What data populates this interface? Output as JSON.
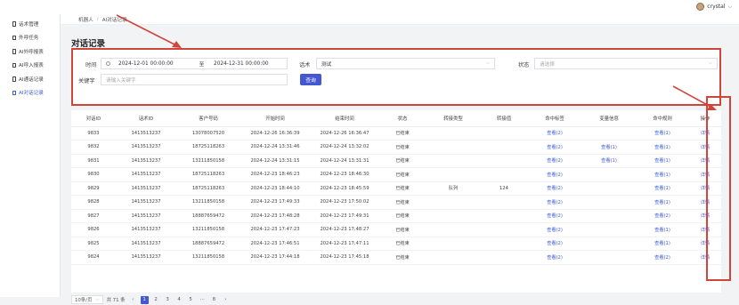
{
  "header": {
    "user_name": "crystal"
  },
  "sidebar": {
    "items": [
      {
        "label": "话术管理",
        "active": false
      },
      {
        "label": "外呼任务",
        "active": false
      },
      {
        "label": "AI外呼报表",
        "active": false
      },
      {
        "label": "AI呼入报表",
        "active": false
      },
      {
        "label": "AI通话记录",
        "active": false
      },
      {
        "label": "AI对话记录",
        "active": true
      }
    ]
  },
  "breadcrumb": [
    "机器人",
    "AI对话记录"
  ],
  "page_title": "对话记录",
  "filter": {
    "time_label": "时间",
    "start_value": "2024-12-01 00:00:00",
    "range_sep": "至",
    "end_value": "2024-12-31 00:00:00",
    "script_label": "话术",
    "script_value": "测试",
    "status_label": "状态",
    "status_placeholder": "请选择",
    "keyword_label": "关键字",
    "keyword_placeholder": "请输入关键字",
    "search_button": "查询"
  },
  "table": {
    "columns": [
      "对话ID",
      "话术ID",
      "客户号码",
      "开始时间",
      "结束时间",
      "状态",
      "转接类型",
      "转接值",
      "命中标签",
      "变量信息",
      "命中规则",
      "操作"
    ],
    "rows": [
      [
        "9833",
        "1413513237",
        "13078007520",
        "2024-12-26 16:36:39",
        "2024-12-26 16:36:47",
        "已结束",
        "",
        "",
        "查看(2)",
        "",
        "查看(1)",
        "详情"
      ],
      [
        "9832",
        "1413513237",
        "18725118263",
        "2024-12-24 13:31:46",
        "2024-12-24 13:32:02",
        "已结束",
        "",
        "",
        "查看(2)",
        "查看(1)",
        "查看(1)",
        "详情"
      ],
      [
        "9831",
        "1413513237",
        "13211850158",
        "2024-12-24 13:31:15",
        "2024-12-24 13:31:31",
        "已结束",
        "",
        "",
        "查看(2)",
        "查看(1)",
        "查看(1)",
        "详情"
      ],
      [
        "9830",
        "1413513237",
        "18725118263",
        "2024-12-23 18:46:23",
        "2024-12-23 18:46:30",
        "已结束",
        "",
        "",
        "查看(2)",
        "",
        "查看(1)",
        "详情"
      ],
      [
        "9829",
        "1413513237",
        "18725118263",
        "2024-12-23 18:44:10",
        "2024-12-23 18:45:59",
        "已结束",
        "队列",
        "124",
        "查看(2)",
        "",
        "查看(1)",
        "详情"
      ],
      [
        "9828",
        "1413513237",
        "13211850158",
        "2024-12-23 17:49:33",
        "2024-12-23 17:50:02",
        "已结束",
        "",
        "",
        "查看(2)",
        "",
        "查看(1)",
        "详情"
      ],
      [
        "9827",
        "1413513237",
        "18887659472",
        "2024-12-23 17:48:28",
        "2024-12-23 17:49:31",
        "已结束",
        "",
        "",
        "查看(2)",
        "",
        "查看(2)",
        "详情"
      ],
      [
        "9826",
        "1413513237",
        "13211850158",
        "2024-12-23 17:47:23",
        "2024-12-23 17:48:27",
        "已结束",
        "",
        "",
        "查看(2)",
        "",
        "查看(1)",
        "详情"
      ],
      [
        "9825",
        "1413513237",
        "18887659472",
        "2024-12-23 17:46:51",
        "2024-12-23 17:47:11",
        "已结束",
        "",
        "",
        "查看(2)",
        "",
        "查看(1)",
        "详情"
      ],
      [
        "9824",
        "1413513237",
        "13211850158",
        "2024-12-23 17:44:18",
        "2024-12-23 17:45:18",
        "已结束",
        "",
        "",
        "查看(2)",
        "",
        "查看(2)",
        "详情"
      ]
    ]
  },
  "pagination": {
    "page_size": "10条/页",
    "total": "共 71 条",
    "prev": "‹",
    "pages": [
      "1",
      "2",
      "3",
      "4",
      "5",
      "···",
      "8"
    ],
    "next": "›",
    "current": "1"
  },
  "colors": {
    "primary": "#4358d0",
    "annotation": "#d0453a",
    "link": "#3d5bd6"
  }
}
